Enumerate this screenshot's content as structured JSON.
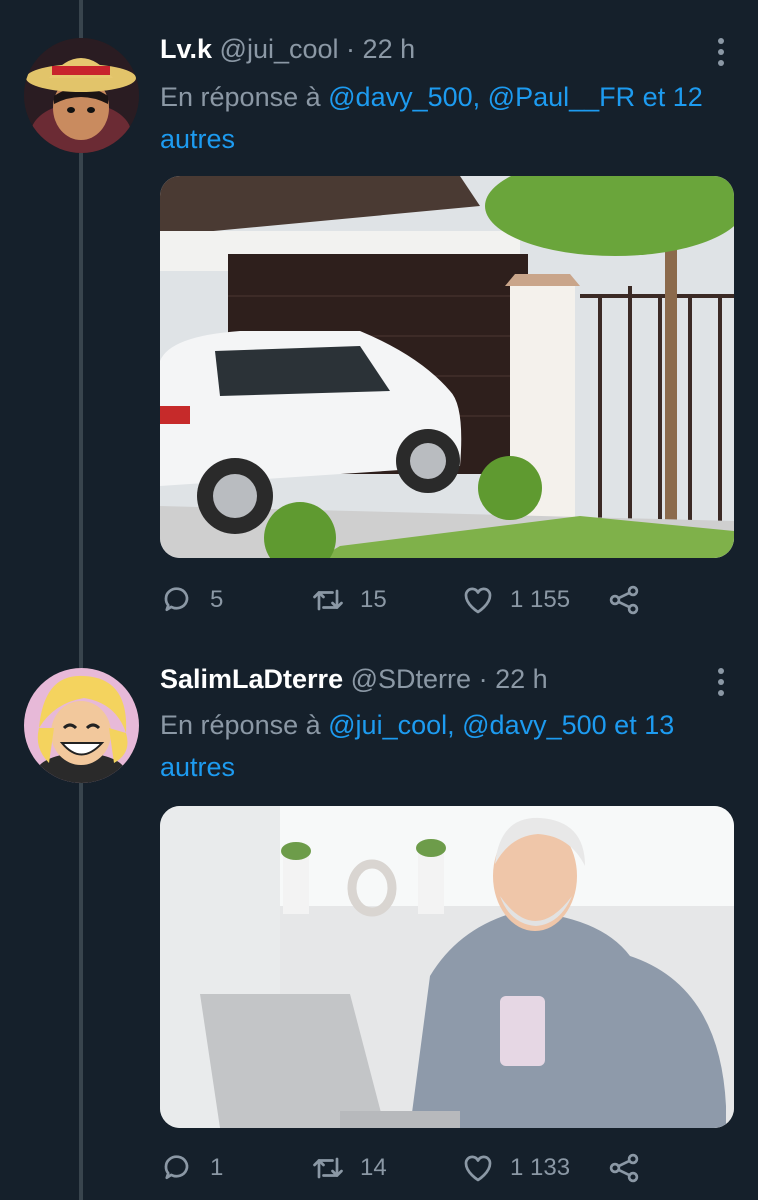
{
  "tweets": [
    {
      "name": "Lv.k",
      "handle": "@jui_cool",
      "separator": "·",
      "time": "22 h",
      "reply_prefix": "En réponse à",
      "mention_1": "@davy_500,",
      "mention_2": "@Paul__FR",
      "reply_joiner": "et",
      "others": "12 autres",
      "replies": "5",
      "retweets": "15",
      "likes": "1 155",
      "media_desc": "white SUV parked in front of a house garage"
    },
    {
      "name": "SalimLaDterre",
      "handle": "@SDterre",
      "separator": "·",
      "time": "22 h",
      "reply_prefix": "En réponse à",
      "mention_1": "@jui_cool,",
      "mention_2": "@davy_500",
      "reply_joiner": "et",
      "others": "13 autres",
      "replies": "1",
      "retweets": "14",
      "likes": "1 133",
      "media_desc": "older man smiling with coffee mug at laptop"
    }
  ],
  "icons": {
    "reply": "speech-bubble-icon",
    "retweet": "retweet-icon",
    "like": "heart-icon",
    "share": "share-icon",
    "more": "vertical-dots-icon"
  },
  "colors": {
    "background": "#15202b",
    "accent": "#1d9bf0",
    "muted": "#8b98a5"
  }
}
